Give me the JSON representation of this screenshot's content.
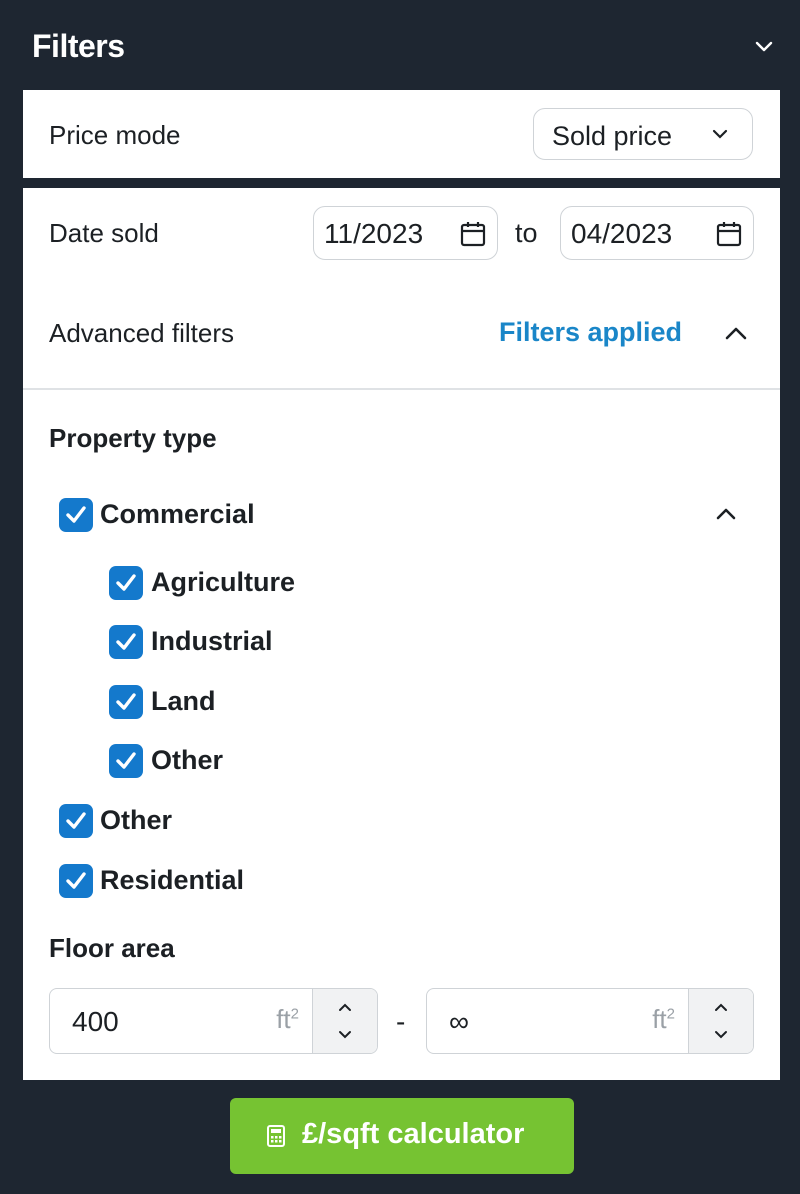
{
  "header": {
    "title": "Filters",
    "collapse_icon": "chevron-down-icon"
  },
  "price_mode": {
    "label": "Price mode",
    "selected": "Sold price"
  },
  "date_sold": {
    "label": "Date sold",
    "from": "11/2023",
    "separator": "to",
    "to": "04/2023"
  },
  "advanced_filters": {
    "label": "Advanced filters",
    "status": "Filters applied",
    "expanded": true
  },
  "property_type": {
    "title": "Property type",
    "items": [
      {
        "label": "Commercial",
        "checked": true,
        "expanded": true,
        "children": [
          {
            "label": "Agriculture",
            "checked": true
          },
          {
            "label": "Industrial",
            "checked": true
          },
          {
            "label": "Land",
            "checked": true
          },
          {
            "label": "Other",
            "checked": true
          }
        ]
      },
      {
        "label": "Other",
        "checked": true
      },
      {
        "label": "Residential",
        "checked": true
      }
    ]
  },
  "floor_area": {
    "title": "Floor area",
    "min": "400",
    "max": "∞",
    "unit": "ft",
    "unit_sup": "2",
    "separator": "-"
  },
  "calculator_button": {
    "label": "£/sqft calculator",
    "icon": "calculator-icon"
  },
  "colors": {
    "background": "#1e2631",
    "accent_blue": "#1a86c8",
    "checkbox": "#1479cc",
    "button_green": "#76c332"
  }
}
